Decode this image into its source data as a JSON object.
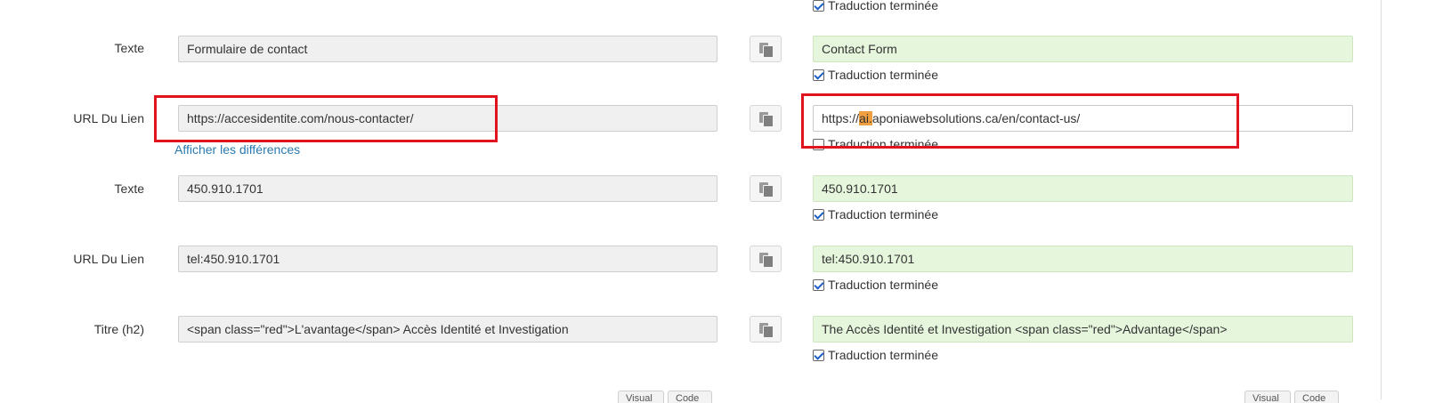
{
  "top_checkbox": {
    "label": "Traduction terminée",
    "checked": true
  },
  "rows": [
    {
      "label": "Texte",
      "source": "Formulaire de contact",
      "target": "Contact Form",
      "done_label": "Traduction terminée",
      "done": true
    },
    {
      "label": "URL Du Lien",
      "source": "https://accesidentite.com/nous-contacter/",
      "target_pre": "https://",
      "target_highlight": "ai.",
      "target_post": "aponiawebsolutions.ca/en/contact-us/",
      "done_label": "Traduction terminée",
      "done": false,
      "diff_link": "Afficher les différences"
    },
    {
      "label": "Texte",
      "source": "450.910.1701",
      "target": "450.910.1701",
      "done_label": "Traduction terminée",
      "done": true
    },
    {
      "label": "URL Du Lien",
      "source": "tel:450.910.1701",
      "target": "tel:450.910.1701",
      "done_label": "Traduction terminée",
      "done": true
    },
    {
      "label": "Titre (h2)",
      "source": "<span class=\"red\">L'avantage</span>  Accès Identité et Investigation",
      "target": "The Accès Identité et Investigation <span class=\"red\">Advantage</span>",
      "done_label": "Traduction terminée",
      "done": true
    }
  ],
  "bottom_buttons": {
    "left": [
      "Visual",
      "Code"
    ],
    "right": [
      "Visual",
      "Code"
    ]
  },
  "colors": {
    "target_bg": "#e6f6dd",
    "source_bg": "#f0f0f0",
    "annotation_red": "#e0141e",
    "highlight": "#f0a040",
    "link": "#2a7ab0"
  },
  "icons": {
    "copy": "copy-icon"
  }
}
